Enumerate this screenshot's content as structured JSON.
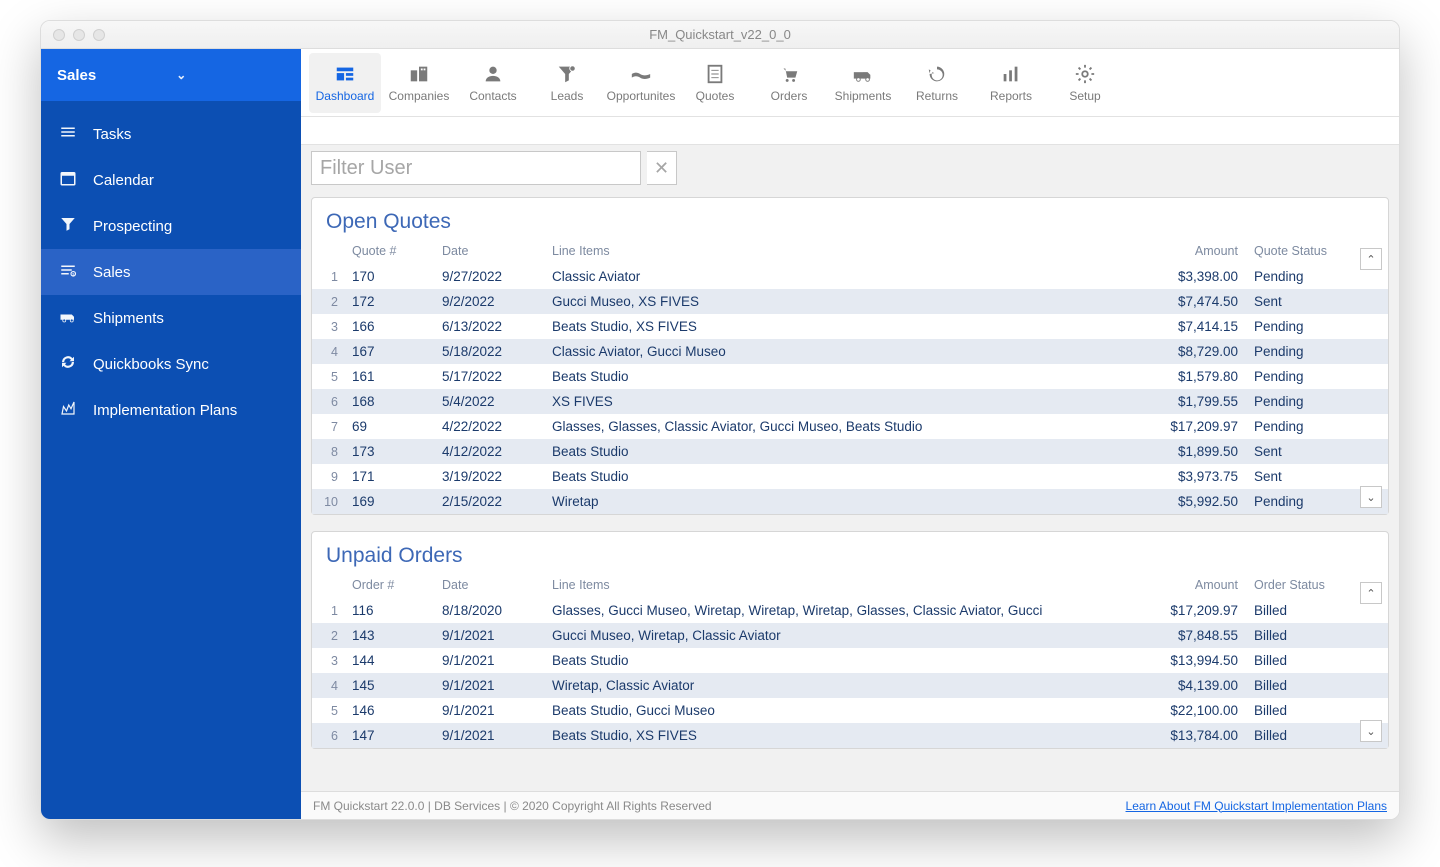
{
  "window_title": "FM_Quickstart_v22_0_0",
  "sidebar": {
    "header": "Sales",
    "items": [
      {
        "label": "Tasks",
        "icon": "tasks"
      },
      {
        "label": "Calendar",
        "icon": "calendar"
      },
      {
        "label": "Prospecting",
        "icon": "funnel"
      },
      {
        "label": "Sales",
        "icon": "sales",
        "active": true
      },
      {
        "label": "Shipments",
        "icon": "shipments"
      },
      {
        "label": "Quickbooks Sync",
        "icon": "sync"
      },
      {
        "label": "Implementation Plans",
        "icon": "plans"
      }
    ]
  },
  "toolbar": [
    {
      "label": "Dashboard",
      "icon": "dashboard",
      "active": true
    },
    {
      "label": "Companies",
      "icon": "companies"
    },
    {
      "label": "Contacts",
      "icon": "contacts"
    },
    {
      "label": "Leads",
      "icon": "leads"
    },
    {
      "label": "Opportunites",
      "icon": "opportunities"
    },
    {
      "label": "Quotes",
      "icon": "quotes"
    },
    {
      "label": "Orders",
      "icon": "orders"
    },
    {
      "label": "Shipments",
      "icon": "shipments"
    },
    {
      "label": "Returns",
      "icon": "returns"
    },
    {
      "label": "Reports",
      "icon": "reports"
    },
    {
      "label": "Setup",
      "icon": "setup"
    }
  ],
  "filter_placeholder": "Filter User",
  "quotes_panel": {
    "title": "Open Quotes",
    "columns": [
      "Quote #",
      "Date",
      "Line Items",
      "Amount",
      "Quote Status"
    ],
    "rows": [
      {
        "n": 1,
        "num": "170",
        "date": "9/27/2022",
        "items": "Classic Aviator",
        "amount": "$3,398.00",
        "status": "Pending"
      },
      {
        "n": 2,
        "num": "172",
        "date": "9/2/2022",
        "items": "Gucci Museo, XS FIVES",
        "amount": "$7,474.50",
        "status": "Sent"
      },
      {
        "n": 3,
        "num": "166",
        "date": "6/13/2022",
        "items": "Beats Studio, XS FIVES",
        "amount": "$7,414.15",
        "status": "Pending"
      },
      {
        "n": 4,
        "num": "167",
        "date": "5/18/2022",
        "items": "Classic Aviator, Gucci Museo",
        "amount": "$8,729.00",
        "status": "Pending"
      },
      {
        "n": 5,
        "num": "161",
        "date": "5/17/2022",
        "items": "Beats Studio",
        "amount": "$1,579.80",
        "status": "Pending"
      },
      {
        "n": 6,
        "num": "168",
        "date": "5/4/2022",
        "items": "XS FIVES",
        "amount": "$1,799.55",
        "status": "Pending"
      },
      {
        "n": 7,
        "num": "69",
        "date": "4/22/2022",
        "items": "Glasses, Glasses, Classic Aviator, Gucci Museo, Beats Studio",
        "amount": "$17,209.97",
        "status": "Pending"
      },
      {
        "n": 8,
        "num": "173",
        "date": "4/12/2022",
        "items": "Beats Studio",
        "amount": "$1,899.50",
        "status": "Sent"
      },
      {
        "n": 9,
        "num": "171",
        "date": "3/19/2022",
        "items": "Beats Studio",
        "amount": "$3,973.75",
        "status": "Sent"
      },
      {
        "n": 10,
        "num": "169",
        "date": "2/15/2022",
        "items": "Wiretap",
        "amount": "$5,992.50",
        "status": "Pending"
      }
    ]
  },
  "orders_panel": {
    "title": "Unpaid Orders",
    "columns": [
      "Order #",
      "Date",
      "Line Items",
      "Amount",
      "Order Status"
    ],
    "rows": [
      {
        "n": 1,
        "num": "116",
        "date": "8/18/2020",
        "items": "Glasses, Gucci Museo, Wiretap, Wiretap, Wiretap, Glasses, Classic Aviator, Gucci",
        "amount": "$17,209.97",
        "status": "Billed"
      },
      {
        "n": 2,
        "num": "143",
        "date": "9/1/2021",
        "items": "Gucci Museo, Wiretap, Classic Aviator",
        "amount": "$7,848.55",
        "status": "Billed"
      },
      {
        "n": 3,
        "num": "144",
        "date": "9/1/2021",
        "items": "Beats Studio",
        "amount": "$13,994.50",
        "status": "Billed"
      },
      {
        "n": 4,
        "num": "145",
        "date": "9/1/2021",
        "items": "Wiretap, Classic Aviator",
        "amount": "$4,139.00",
        "status": "Billed"
      },
      {
        "n": 5,
        "num": "146",
        "date": "9/1/2021",
        "items": "Beats Studio, Gucci Museo",
        "amount": "$22,100.00",
        "status": "Billed"
      },
      {
        "n": 6,
        "num": "147",
        "date": "9/1/2021",
        "items": "Beats Studio, XS FIVES",
        "amount": "$13,784.00",
        "status": "Billed"
      }
    ]
  },
  "footer_left": "FM Quickstart 22.0.0  | DB Services | © 2020 Copyright All Rights Reserved",
  "footer_link": "Learn About FM Quickstart Implementation Plans"
}
